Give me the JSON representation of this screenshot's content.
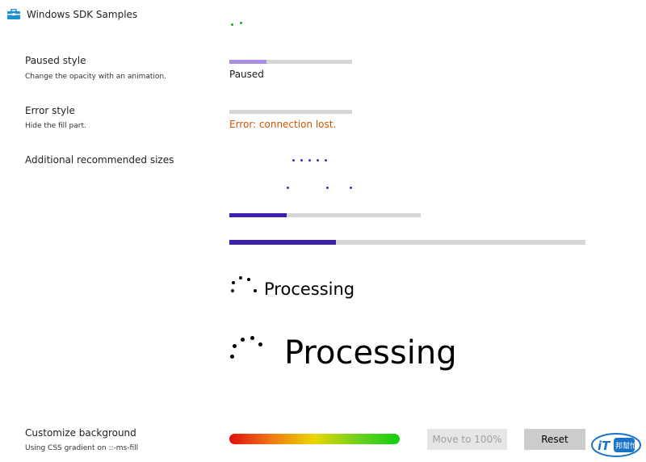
{
  "app": {
    "title": "Windows SDK Samples",
    "icon": "toolbox-icon"
  },
  "sections": {
    "paused": {
      "title": "Paused style",
      "description": "Change the opacity with an animation.",
      "status": "Paused",
      "progress": 0.3,
      "fill_color": "#a98be8"
    },
    "error": {
      "title": "Error style",
      "description": "Hide the fill part.",
      "status": "Error: connection lost.",
      "status_color": "#d35400"
    },
    "sizes": {
      "title": "Additional recommended sizes",
      "bar_small_progress": 0.3,
      "bar_large_progress": 0.3,
      "fill_color": "#3d1fb0"
    },
    "ring_small": {
      "label": "Processing"
    },
    "ring_large": {
      "label": "Processing"
    },
    "customize": {
      "title": "Customize background",
      "description": "Using CSS gradient on ::-ms-fill",
      "move_button": "Move to 100%",
      "reset_button": "Reset"
    }
  },
  "colors": {
    "accent_green": "#2aa12a",
    "accent_purple": "#4b2cc4"
  },
  "watermark": {
    "text": "iT邦幫忙"
  }
}
